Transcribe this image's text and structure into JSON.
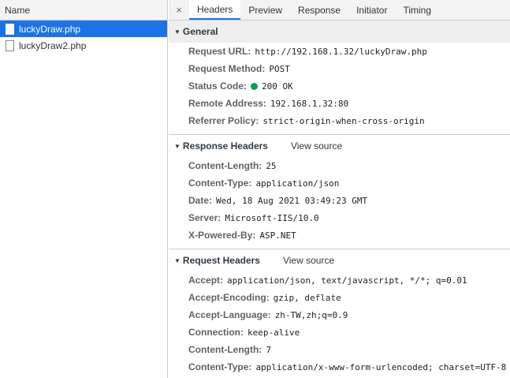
{
  "list": {
    "header": "Name",
    "items": [
      {
        "name": "luckyDraw.php",
        "selected": true
      },
      {
        "name": "luckyDraw2.php",
        "selected": false
      }
    ]
  },
  "tabs": {
    "close": "×",
    "items": [
      "Headers",
      "Preview",
      "Response",
      "Initiator",
      "Timing"
    ],
    "active": "Headers"
  },
  "general": {
    "title": "General",
    "rows": [
      {
        "key": "Request URL:",
        "value": "http://192.168.1.32/luckyDraw.php"
      },
      {
        "key": "Request Method:",
        "value": "POST"
      },
      {
        "key": "Status Code:",
        "value": "200 OK",
        "status_color": "#0f9d58"
      },
      {
        "key": "Remote Address:",
        "value": "192.168.1.32:80"
      },
      {
        "key": "Referrer Policy:",
        "value": "strict-origin-when-cross-origin"
      }
    ]
  },
  "response_headers": {
    "title": "Response Headers",
    "view_source": "View source",
    "rows": [
      {
        "key": "Content-Length:",
        "value": "25"
      },
      {
        "key": "Content-Type:",
        "value": "application/json"
      },
      {
        "key": "Date:",
        "value": "Wed, 18 Aug 2021 03:49:23 GMT"
      },
      {
        "key": "Server:",
        "value": "Microsoft-IIS/10.0"
      },
      {
        "key": "X-Powered-By:",
        "value": "ASP.NET"
      }
    ]
  },
  "request_headers": {
    "title": "Request Headers",
    "view_source": "View source",
    "rows": [
      {
        "key": "Accept:",
        "value": "application/json, text/javascript, */*; q=0.01"
      },
      {
        "key": "Accept-Encoding:",
        "value": "gzip, deflate"
      },
      {
        "key": "Accept-Language:",
        "value": "zh-TW,zh;q=0.9"
      },
      {
        "key": "Connection:",
        "value": "keep-alive"
      },
      {
        "key": "Content-Length:",
        "value": "7"
      },
      {
        "key": "Content-Type:",
        "value": "application/x-www-form-urlencoded; charset=UTF-8"
      }
    ]
  }
}
